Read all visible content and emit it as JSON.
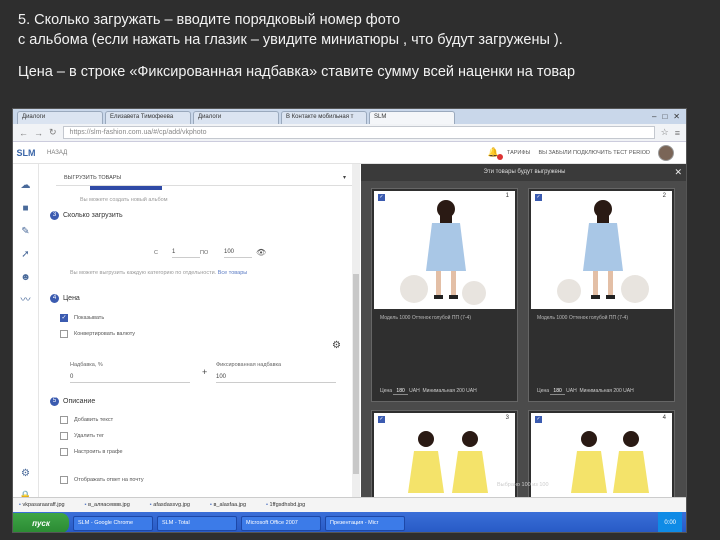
{
  "slide": {
    "line1": "5. Сколько загружать – вводите порядковый номер фото",
    "line2": "с альбома (если нажать на глазик – увидите миниатюры , что будут загружены ).",
    "line3": "Цена – в строке «Фиксированная надбавка» ставите сумму всей наценки на товар"
  },
  "browser": {
    "tabs": [
      "Диалоги",
      "Елизавета Тимофеева",
      "Диалоги",
      "В Контакте мобильная т",
      "SLM"
    ],
    "url": "https://slm-fashion.com.ua/#/cp/add/vkphoto"
  },
  "app": {
    "logo": "SLM",
    "back": "НАЗАД",
    "header_links": [
      "ТАРИФЫ",
      "ВЫ ЗАБЫЛИ ПОДКЛЮЧИТЬ ТЕСТ PERIOD"
    ],
    "notification_count": "1"
  },
  "form": {
    "select_label": "ВЫГРУЗИТЬ ТОВАРЫ",
    "select_hint": "Вы можете создать новый альбом",
    "step3_title": "Сколько загрузить",
    "from_label": "С",
    "from_value": "1",
    "to_label": "ПО",
    "to_value": "100",
    "range_hint": "Вы можете выгрузить каждую категорию по отдельности.",
    "range_link": "Все товары",
    "step4_title": "Цена",
    "show_label": "Показывать",
    "convert_label": "Конвертировать валюту",
    "markup_percent_label": "Надбавка, %",
    "markup_percent_value": "0",
    "fixed_markup_label": "Фиксированная надбавка",
    "fixed_markup_value": "100",
    "step5_title": "Описание",
    "desc_options": [
      "Добавить текст",
      "Удалить тег",
      "Настроить в графе",
      "Отображать ответ на почту"
    ]
  },
  "modal": {
    "title": "Эти товары будут выгружены",
    "cards": [
      {
        "index": "1",
        "desc": "Модель 1000 Оттенок голубой ПП (7-4)",
        "price_label": "Цена",
        "price_value": "180",
        "currency": "UAH",
        "wholesale": "Минимальная 200 UAH"
      },
      {
        "index": "2",
        "desc": "Модель 1000 Оттенок голубой ПП (7-4)",
        "price_label": "Цена",
        "price_value": "180",
        "currency": "UAH",
        "wholesale": "Минимальная 200 UAH"
      },
      {
        "index": "3",
        "desc": "",
        "price_label": "",
        "price_value": "",
        "currency": "",
        "wholesale": ""
      },
      {
        "index": "4",
        "desc": "",
        "price_label": "",
        "price_value": "",
        "currency": "",
        "wholesale": ""
      }
    ],
    "counter": "Выбрано 100 из 100"
  },
  "downloads": [
    "vkpasaraaraff.jpg",
    "в_аляасеввв.jpg",
    "аfasdassvg.jpg",
    "в_аlasfaa.jpg",
    "1ffgsdhsbd.jpg"
  ],
  "taskbar": {
    "start": "пуск",
    "items": [
      "SLM - Google Chrome",
      "SLM - Total",
      "Microsoft Office 2007",
      "Презентация - Micr"
    ],
    "clock": "0:00"
  },
  "colors": {
    "accent": "#3b5bb0",
    "modal_bg": "#4b4b4b",
    "taskbar": "#2658c4",
    "start": "#2b8a33"
  }
}
